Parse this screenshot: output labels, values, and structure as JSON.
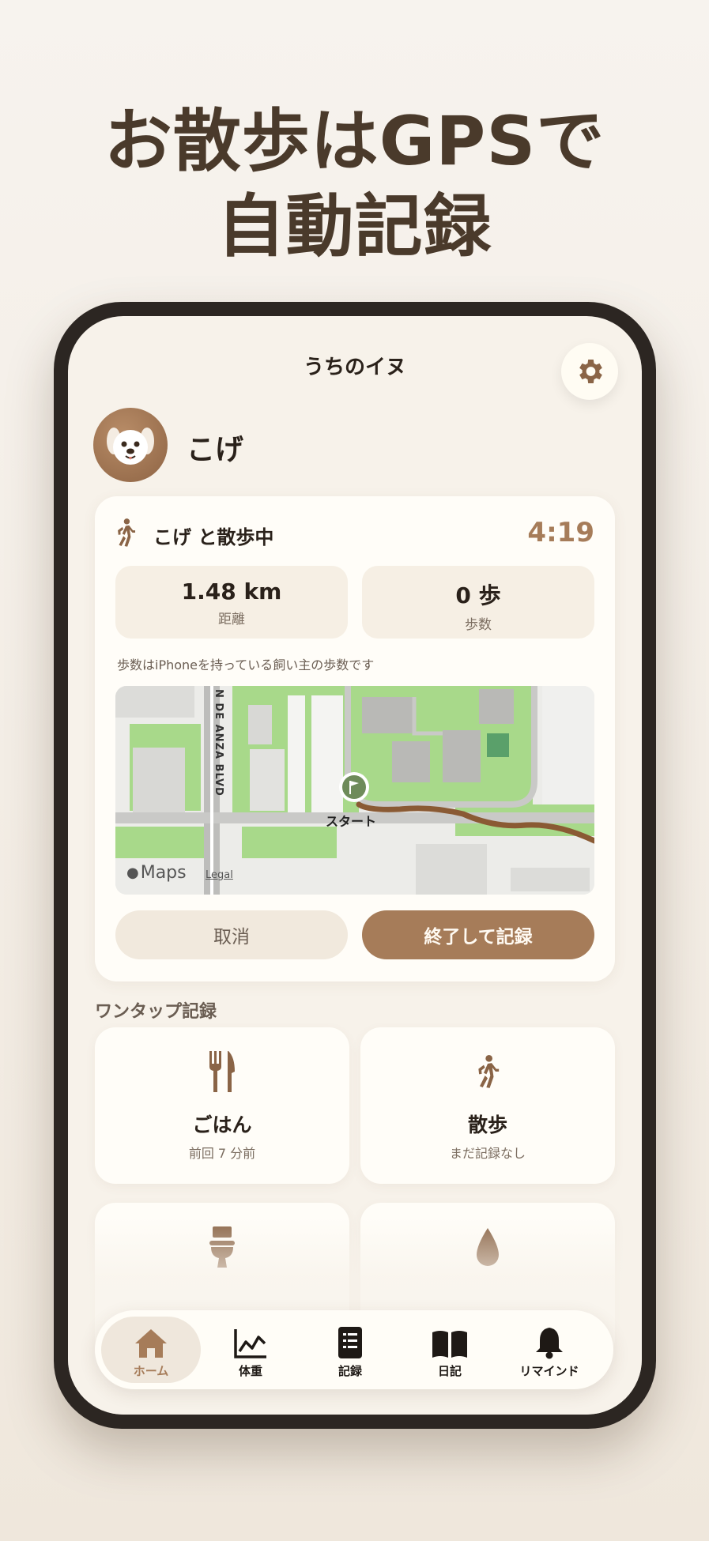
{
  "headline": {
    "line1": "お散歩はGPSで",
    "line2": "自動記録"
  },
  "app": {
    "title": "うちのイヌ",
    "pet_name": "こげ"
  },
  "walk_card": {
    "status": "こげ と散歩中",
    "timer": "4:19",
    "distance_value": "1.48 km",
    "distance_label": "距離",
    "steps_value": "0 歩",
    "steps_label": "歩数",
    "note": "歩数はiPhoneを持っている飼い主の歩数です",
    "map": {
      "street_label": "N DE ANZA BLVD",
      "start_label": "スタート",
      "maps_brand": "Maps",
      "legal": "Legal"
    },
    "cancel_label": "取消",
    "finish_label": "終了して記録"
  },
  "quick_log": {
    "section_title": "ワンタップ記録",
    "tiles": [
      {
        "icon": "fork-knife-icon",
        "name": "ごはん",
        "sub": "前回 7 分前"
      },
      {
        "icon": "walking-person-icon",
        "name": "散歩",
        "sub": "まだ記録なし"
      },
      {
        "icon": "toilet-icon",
        "name": "",
        "sub": ""
      },
      {
        "icon": "water-drop-icon",
        "name": "",
        "sub": ""
      }
    ]
  },
  "tabbar": {
    "tabs": [
      {
        "label": "ホーム",
        "icon": "house-icon",
        "active": true
      },
      {
        "label": "体重",
        "icon": "chart-line-icon",
        "active": false
      },
      {
        "label": "記録",
        "icon": "notebook-icon",
        "active": false
      },
      {
        "label": "日記",
        "icon": "open-book-icon",
        "active": false
      },
      {
        "label": "リマインド",
        "icon": "bell-icon",
        "active": false
      }
    ]
  },
  "colors": {
    "accent": "#a67c59",
    "background": "#f7f2ea",
    "card": "#fffdf8",
    "text": "#2a211a",
    "route": "#8a5a34",
    "map_green": "#a8d98a"
  }
}
